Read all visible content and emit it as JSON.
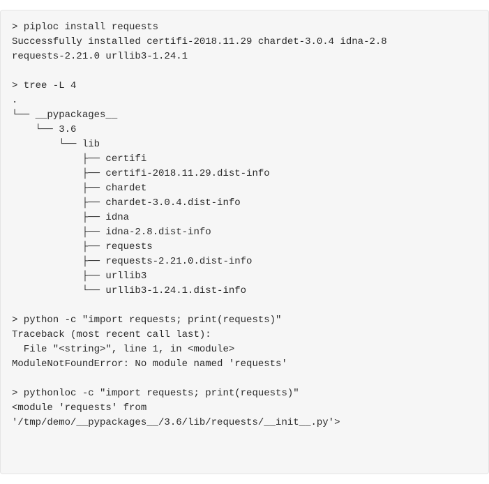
{
  "lines": [
    "> piploc install requests",
    "Successfully installed certifi-2018.11.29 chardet-3.0.4 idna-2.8",
    "requests-2.21.0 urllib3-1.24.1",
    "",
    "> tree -L 4",
    ".",
    "└── __pypackages__",
    "    └── 3.6",
    "        └── lib",
    "            ├── certifi",
    "            ├── certifi-2018.11.29.dist-info",
    "            ├── chardet",
    "            ├── chardet-3.0.4.dist-info",
    "            ├── idna",
    "            ├── idna-2.8.dist-info",
    "            ├── requests",
    "            ├── requests-2.21.0.dist-info",
    "            ├── urllib3",
    "            └── urllib3-1.24.1.dist-info",
    "",
    "> python -c \"import requests; print(requests)\"",
    "Traceback (most recent call last):",
    "  File \"<string>\", line 1, in <module>",
    "ModuleNotFoundError: No module named 'requests'",
    "",
    "> pythonloc -c \"import requests; print(requests)\"",
    "<module 'requests' from",
    "'/tmp/demo/__pypackages__/3.6/lib/requests/__init__.py'>"
  ]
}
